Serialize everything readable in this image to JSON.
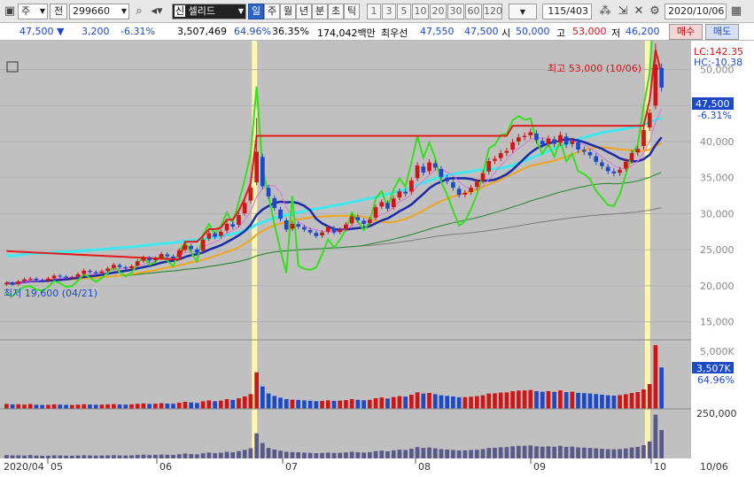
{
  "toolbar": {
    "mode_select": "주",
    "prefix_label": "전",
    "code_value": "299660",
    "stock_tag": "신",
    "stock_name": "셀리드",
    "period_buttons": [
      "일",
      "주",
      "월",
      "년",
      "분",
      "초",
      "틱"
    ],
    "active_period": "일",
    "interval_buttons": [
      "1",
      "3",
      "5",
      "10",
      "20",
      "30",
      "60",
      "120"
    ],
    "count_value": "115/403",
    "date_value": "2020/10/06"
  },
  "info": {
    "price": "47,500",
    "change": "3,200",
    "change_pct": "-6.31%",
    "volume": "3,507,469",
    "vol_ratio": "64.96%",
    "turnover": "36.35%",
    "amount": "174,042백만",
    "best_ask_label": "최우선",
    "best_ask": "47,550",
    "best_bid": "47,500",
    "open_label": "시",
    "open": "50,000",
    "high_label": "고",
    "high": "53,000",
    "low_label": "저",
    "low": "46,200",
    "buy_button": "매수",
    "sell_button": "매도"
  },
  "chart": {
    "lc_label": "LC:142.35",
    "hc_label": "HC:-10.38",
    "max_annotation": "최고 53,000 (10/06)",
    "min_annotation": "최저 19,600 (04/21)",
    "current_price_tag": "47,500",
    "current_pct_tag": "-6.31%",
    "volume_tag": "3,507K",
    "volume_pct_tag": "64.96%",
    "colors": {
      "up": "#d01515",
      "down": "#1c49c8",
      "bg": "#c0c0c0"
    }
  },
  "chart_data": {
    "type": "candlestick",
    "price_axis": {
      "ticks": [
        15000,
        20000,
        25000,
        30000,
        35000,
        40000,
        45000,
        50000
      ],
      "labels": [
        "15,000",
        "20,000",
        "25,000",
        "30,000",
        "35,000",
        "40,000",
        "45,000",
        "50,000"
      ],
      "range": [
        12500,
        54000
      ]
    },
    "volume_axis": {
      "ticks": [
        5000000
      ],
      "labels": [
        "5,000K"
      ]
    },
    "turnover_axis": {
      "ticks": [
        250000
      ],
      "labels": [
        "250,000"
      ]
    },
    "x_labels": [
      "2020/04",
      "05",
      "06",
      "07",
      "08",
      "09",
      "10",
      "10/06"
    ],
    "close": [
      20400,
      20200,
      20600,
      20900,
      21000,
      20800,
      20700,
      21000,
      21400,
      21300,
      21100,
      21200,
      21600,
      22100,
      21900,
      21700,
      22000,
      22400,
      22900,
      22600,
      22400,
      22700,
      23400,
      23900,
      23500,
      23800,
      24400,
      24100,
      23800,
      24900,
      25600,
      25100,
      24600,
      26400,
      27300,
      26800,
      27500,
      28600,
      28200,
      29800,
      31500,
      33600,
      38600,
      33800,
      32400,
      30800,
      29300,
      27800,
      28600,
      28200,
      27800,
      27400,
      26900,
      27400,
      28100,
      27400,
      27800,
      28500,
      29600,
      29100,
      28600,
      29200,
      30900,
      31600,
      30700,
      32100,
      33100,
      32800,
      34600,
      36700,
      35700,
      37100,
      36400,
      35100,
      34500,
      33600,
      32600,
      32900,
      33600,
      34400,
      35600,
      37300,
      37600,
      38400,
      38700,
      39900,
      40600,
      40800,
      41300,
      40200,
      39600,
      40400,
      39700,
      40900,
      39600,
      40100,
      38900,
      38600,
      38100,
      37200,
      36600,
      35900,
      35600,
      36100,
      37200,
      38400,
      39000,
      41600,
      44000,
      50700,
      47500
    ],
    "volume_values": [
      420000,
      380000,
      390000,
      360000,
      410000,
      350000,
      330000,
      340000,
      380000,
      360000,
      340000,
      330000,
      360000,
      390000,
      370000,
      350000,
      360000,
      380000,
      400000,
      370000,
      360000,
      380000,
      430000,
      460000,
      420000,
      440000,
      480000,
      450000,
      430000,
      520000,
      600000,
      540000,
      500000,
      640000,
      720000,
      650000,
      700000,
      820000,
      760000,
      900000,
      1050000,
      1250000,
      3100000,
      1900000,
      1300000,
      1100000,
      950000,
      820000,
      780000,
      760000,
      720000,
      690000,
      650000,
      680000,
      720000,
      680000,
      700000,
      740000,
      820000,
      770000,
      730000,
      770000,
      900000,
      960000,
      880000,
      1000000,
      1080000,
      1040000,
      1200000,
      1400000,
      1300000,
      1350000,
      1250000,
      1150000,
      1100000,
      1050000,
      980000,
      990000,
      1030000,
      1080000,
      1150000,
      1300000,
      1320000,
      1380000,
      1400000,
      1500000,
      1550000,
      1560000,
      1600000,
      1500000,
      1450000,
      1500000,
      1440000,
      1560000,
      1420000,
      1460000,
      1360000,
      1330000,
      1300000,
      1250000,
      1200000,
      1150000,
      1120000,
      1160000,
      1240000,
      1350000,
      1420000,
      1650000,
      2100000,
      5400000,
      3507469
    ]
  }
}
